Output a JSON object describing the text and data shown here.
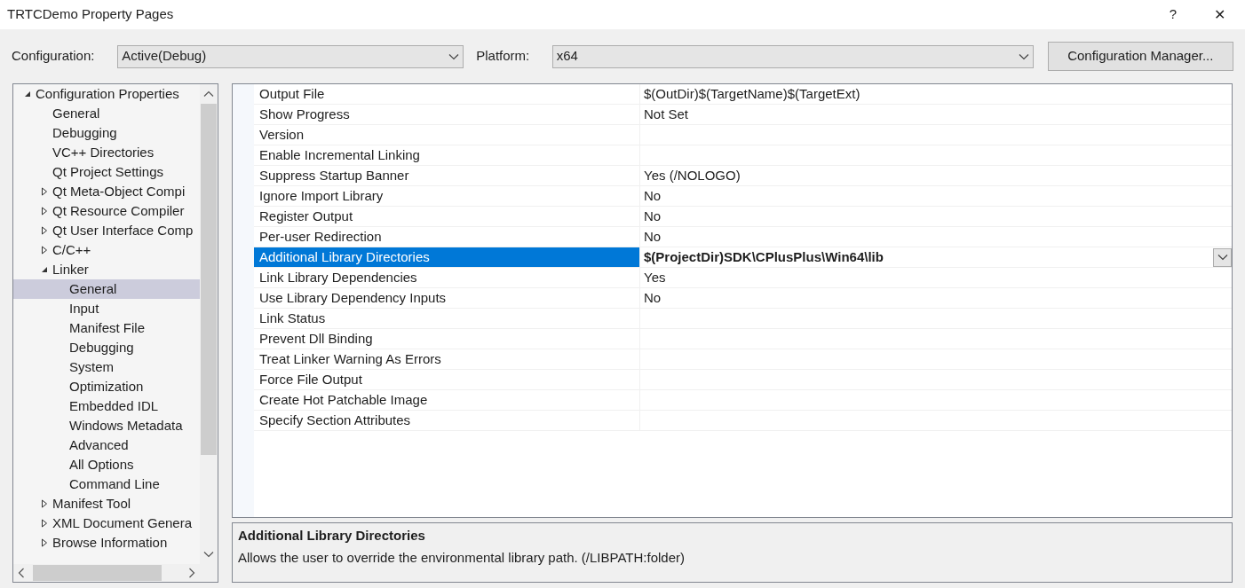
{
  "window": {
    "title": "TRTCDemo Property Pages",
    "help": "?",
    "close": "✕"
  },
  "toolbar": {
    "configuration_label": "Configuration:",
    "configuration_value": "Active(Debug)",
    "platform_label": "Platform:",
    "platform_value": "x64",
    "manager_button": "Configuration Manager..."
  },
  "tree": {
    "items": [
      {
        "label": "Configuration Properties",
        "expanded": true,
        "selected": false,
        "children": [
          {
            "label": "General",
            "selected": false
          },
          {
            "label": "Debugging",
            "selected": false
          },
          {
            "label": "VC++ Directories",
            "selected": false
          },
          {
            "label": "Qt Project Settings",
            "selected": false
          },
          {
            "label": "Qt Meta-Object Compi",
            "expanded": false,
            "selected": false
          },
          {
            "label": "Qt Resource Compiler",
            "expanded": false,
            "selected": false
          },
          {
            "label": "Qt User Interface Comp",
            "expanded": false,
            "selected": false
          },
          {
            "label": "C/C++",
            "expanded": false,
            "selected": false
          },
          {
            "label": "Linker",
            "expanded": true,
            "selected": false,
            "children": [
              {
                "label": "General",
                "selected": true
              },
              {
                "label": "Input",
                "selected": false
              },
              {
                "label": "Manifest File",
                "selected": false
              },
              {
                "label": "Debugging",
                "selected": false
              },
              {
                "label": "System",
                "selected": false
              },
              {
                "label": "Optimization",
                "selected": false
              },
              {
                "label": "Embedded IDL",
                "selected": false
              },
              {
                "label": "Windows Metadata",
                "selected": false
              },
              {
                "label": "Advanced",
                "selected": false
              },
              {
                "label": "All Options",
                "selected": false
              },
              {
                "label": "Command Line",
                "selected": false
              }
            ]
          },
          {
            "label": "Manifest Tool",
            "expanded": false,
            "selected": false
          },
          {
            "label": "XML Document Genera",
            "expanded": false,
            "selected": false
          },
          {
            "label": "Browse Information",
            "expanded": false,
            "selected": false
          }
        ]
      }
    ]
  },
  "grid": {
    "rows": [
      {
        "name": "Output File",
        "value": "$(OutDir)$(TargetName)$(TargetExt)",
        "selected": false,
        "modified": false
      },
      {
        "name": "Show Progress",
        "value": "Not Set",
        "selected": false,
        "modified": false
      },
      {
        "name": "Version",
        "selected": false
      },
      {
        "name": "Enable Incremental Linking",
        "selected": false
      },
      {
        "name": "Suppress Startup Banner",
        "value": "Yes (/NOLOGO)",
        "selected": false,
        "modified": false
      },
      {
        "name": "Ignore Import Library",
        "value": "No",
        "selected": false,
        "modified": false
      },
      {
        "name": "Register Output",
        "value": "No",
        "selected": false,
        "modified": false
      },
      {
        "name": "Per-user Redirection",
        "value": "No",
        "selected": false,
        "modified": false
      },
      {
        "name": "Additional Library Directories",
        "value": "$(ProjectDir)SDK\\CPlusPlus\\Win64\\lib",
        "selected": true,
        "modified": true
      },
      {
        "name": "Link Library Dependencies",
        "value": "Yes",
        "selected": false,
        "modified": false
      },
      {
        "name": "Use Library Dependency Inputs",
        "value": "No",
        "selected": false,
        "modified": false
      },
      {
        "name": "Link Status",
        "selected": false
      },
      {
        "name": "Prevent Dll Binding",
        "selected": false
      },
      {
        "name": "Treat Linker Warning As Errors",
        "selected": false
      },
      {
        "name": "Force File Output",
        "selected": false
      },
      {
        "name": "Create Hot Patchable Image",
        "selected": false
      },
      {
        "name": "Specify Section Attributes",
        "selected": false
      }
    ]
  },
  "description": {
    "title": "Additional Library Directories",
    "text": "Allows the user to override the environmental library path. (/LIBPATH:folder)"
  }
}
